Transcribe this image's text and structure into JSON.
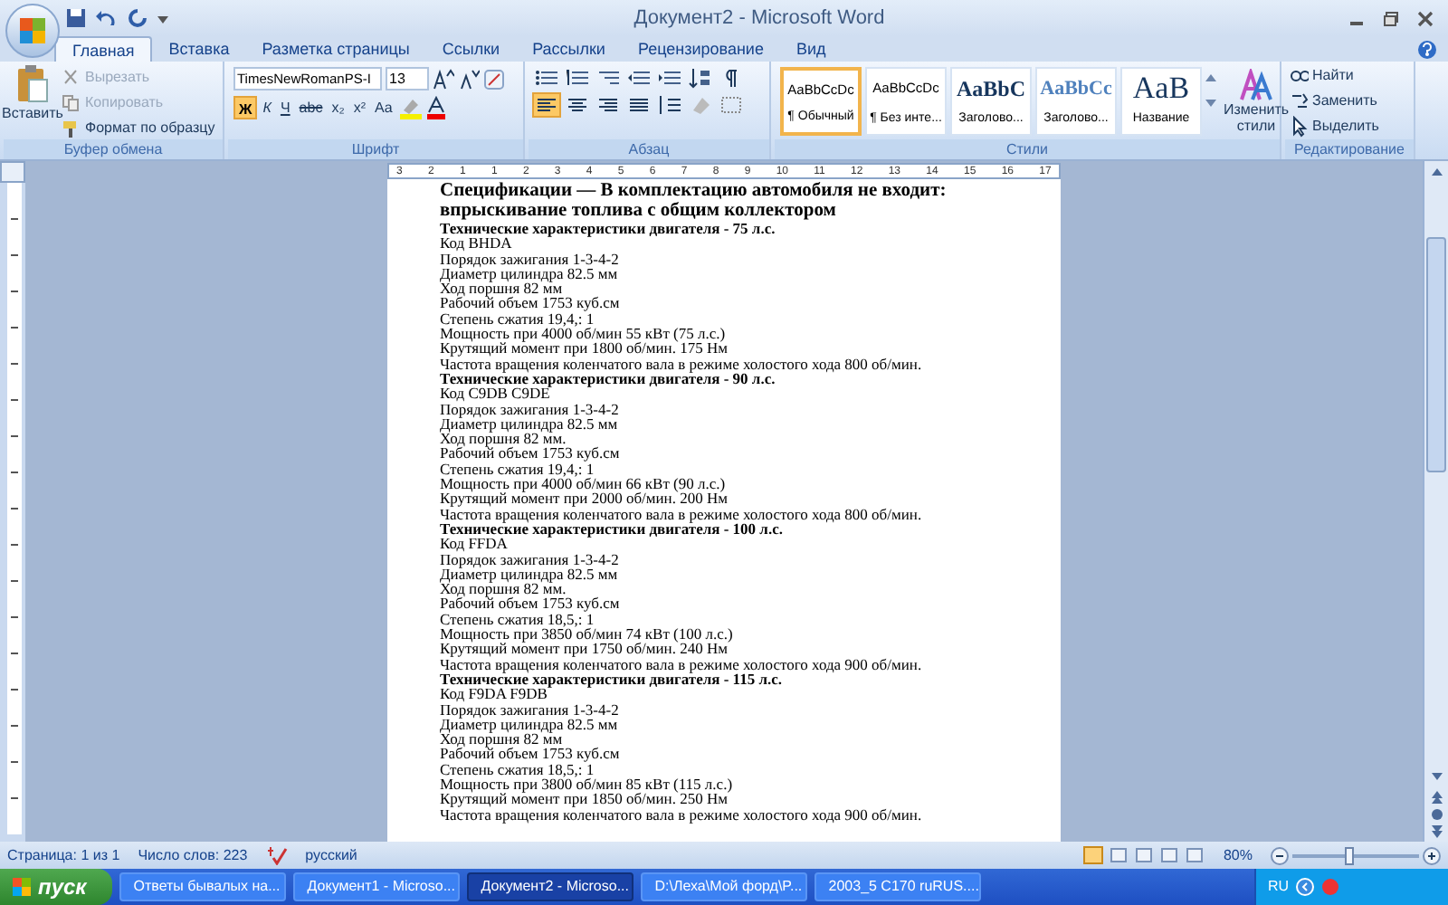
{
  "window": {
    "title": "Документ2 - Microsoft Word"
  },
  "tabs": [
    {
      "label": "Главная",
      "selected": true
    },
    {
      "label": "Вставка",
      "selected": false
    },
    {
      "label": "Разметка страницы",
      "selected": false
    },
    {
      "label": "Ссылки",
      "selected": false
    },
    {
      "label": "Рассылки",
      "selected": false
    },
    {
      "label": "Рецензирование",
      "selected": false
    },
    {
      "label": "Вид",
      "selected": false
    }
  ],
  "clipboard": {
    "label": "Буфер обмена",
    "paste": "Вставить",
    "items": [
      {
        "label": "Вырезать",
        "disabled": true
      },
      {
        "label": "Копировать",
        "disabled": true
      },
      {
        "label": "Формат по образцу",
        "disabled": false
      }
    ]
  },
  "font": {
    "label": "Шрифт",
    "name": "TimesNewRomanPS-I",
    "size": "13",
    "buttons": [
      {
        "label": "Ж",
        "selected": true
      },
      {
        "label": "К",
        "selected": false
      },
      {
        "label": "Ч",
        "selected": false
      },
      {
        "label": "abc",
        "selected": false
      },
      {
        "label": "x₂",
        "selected": false
      },
      {
        "label": "x²",
        "selected": false
      },
      {
        "label": "Aa",
        "selected": false
      }
    ]
  },
  "paragraph": {
    "label": "Абзац",
    "alignments": [
      {
        "kind": "left",
        "selected": true
      },
      {
        "kind": "center",
        "selected": false
      },
      {
        "kind": "right",
        "selected": false
      },
      {
        "kind": "justify",
        "selected": false
      }
    ]
  },
  "styles": {
    "label": "Стили",
    "items": [
      {
        "preview": "AaBbCcDc",
        "name": "¶ Обычный",
        "selected": true
      },
      {
        "preview": "AaBbCcDc",
        "name": "¶ Без инте...",
        "selected": false
      },
      {
        "preview": "AaBbC",
        "name": "Заголово...",
        "selected": false
      },
      {
        "preview": "AaBbCc",
        "name": "Заголово...",
        "selected": false
      },
      {
        "preview": "AaB",
        "name": "Название",
        "selected": false
      }
    ],
    "change": "Изменить стили"
  },
  "editing": {
    "label": "Редактирование",
    "items": [
      "Найти",
      "Заменить",
      "Выделить"
    ]
  },
  "ruler_marks": [
    "3",
    "2",
    "1",
    "1",
    "2",
    "3",
    "4",
    "5",
    "6",
    "7",
    "8",
    "9",
    "10",
    "11",
    "12",
    "13",
    "14",
    "15",
    "16",
    "17"
  ],
  "document": [
    {
      "kind": "heading",
      "text": "Спецификации — В комплектацию автомобиля не входит: впрыскивание топлива с общим коллектором"
    },
    {
      "kind": "bold",
      "text": "Технические характеристики двигателя - 75 л.с."
    },
    {
      "kind": "normal",
      "text": "Код BHDA"
    },
    {
      "kind": "normal",
      "text": "Порядок зажигания 1-3-4-2"
    },
    {
      "kind": "normal",
      "text": "Диаметр цилиндра 82.5 мм"
    },
    {
      "kind": "normal",
      "text": "Ход поршня 82 мм"
    },
    {
      "kind": "normal",
      "text": "Рабочий объем 1753 куб.см"
    },
    {
      "kind": "normal",
      "text": "Степень сжатия 19,4,: 1"
    },
    {
      "kind": "normal",
      "text": "Мощность при 4000 об/мин 55 кВт (75 л.с.)"
    },
    {
      "kind": "normal",
      "text": "Крутящий момент при 1800 об/мин. 175 Нм"
    },
    {
      "kind": "normal",
      "text": "Частота вращения коленчатого вала в режиме холостого хода 800 об/мин."
    },
    {
      "kind": "bold",
      "text": "Технические характеристики двигателя - 90 л.с."
    },
    {
      "kind": "normal",
      "text": "Код C9DB C9DE"
    },
    {
      "kind": "normal",
      "text": "Порядок зажигания 1-3-4-2"
    },
    {
      "kind": "normal",
      "text": "Диаметр цилиндра 82.5 мм"
    },
    {
      "kind": "normal",
      "text": "Ход поршня 82 мм."
    },
    {
      "kind": "normal",
      "text": "Рабочий объем 1753 куб.см"
    },
    {
      "kind": "normal",
      "text": "Степень сжатия 19,4,: 1"
    },
    {
      "kind": "normal",
      "text": "Мощность при 4000 об/мин 66 кВт (90 л.с.)"
    },
    {
      "kind": "normal",
      "text": "Крутящий момент при 2000 об/мин. 200 Нм"
    },
    {
      "kind": "normal",
      "text": "Частота вращения коленчатого вала в режиме холостого хода 800 об/мин."
    },
    {
      "kind": "bold",
      "text": "Технические характеристики двигателя - 100 л.с."
    },
    {
      "kind": "normal",
      "text": "Код FFDA"
    },
    {
      "kind": "normal",
      "text": "Порядок зажигания 1-3-4-2"
    },
    {
      "kind": "normal",
      "text": "Диаметр цилиндра 82.5 мм"
    },
    {
      "kind": "normal",
      "text": "Ход поршня 82 мм."
    },
    {
      "kind": "normal",
      "text": "Рабочий объем 1753 куб.см"
    },
    {
      "kind": "normal",
      "text": "Степень сжатия 18,5,: 1"
    },
    {
      "kind": "normal",
      "text": "Мощность при 3850 об/мин 74 кВт (100 л.с.)"
    },
    {
      "kind": "normal",
      "text": "Крутящий момент при 1750 об/мин. 240 Нм"
    },
    {
      "kind": "normal",
      "text": "Частота вращения коленчатого вала в режиме холостого хода 900 об/мин."
    },
    {
      "kind": "bold",
      "text": "Технические характеристики двигателя - 115 л.с."
    },
    {
      "kind": "normal",
      "text": "Код F9DA F9DB"
    },
    {
      "kind": "normal",
      "text": "Порядок зажигания 1-3-4-2"
    },
    {
      "kind": "normal",
      "text": "Диаметр цилиндра 82.5 мм"
    },
    {
      "kind": "normal",
      "text": "Ход поршня 82 мм"
    },
    {
      "kind": "normal",
      "text": "Рабочий объем 1753 куб.см"
    },
    {
      "kind": "normal",
      "text": "Степень сжатия 18,5,: 1"
    },
    {
      "kind": "normal",
      "text": "Мощность при 3800 об/мин 85 кВт (115 л.с.)"
    },
    {
      "kind": "normal",
      "text": "Крутящий момент при 1850 об/мин. 250 Нм"
    },
    {
      "kind": "normal",
      "text": "Частота вращения коленчатого вала в режиме холостого хода 900 об/мин."
    }
  ],
  "status_bar": {
    "page": "Страница: 1 из 1",
    "words": "Число слов: 223",
    "language": "русский",
    "zoom": {
      "label": "80%",
      "level": 0.45
    }
  },
  "taskbar": {
    "start": "пуск",
    "tasks": [
      {
        "label": "Ответы бывалых на...",
        "selected": false
      },
      {
        "label": "Документ1 - Microso...",
        "selected": false
      },
      {
        "label": "Документ2 - Microso...",
        "selected": true
      },
      {
        "label": "D:\\Леха\\Мой форд\\P...",
        "selected": false
      },
      {
        "label": "2003_5 C170 ruRUS....",
        "selected": false
      }
    ],
    "language": "RU"
  }
}
